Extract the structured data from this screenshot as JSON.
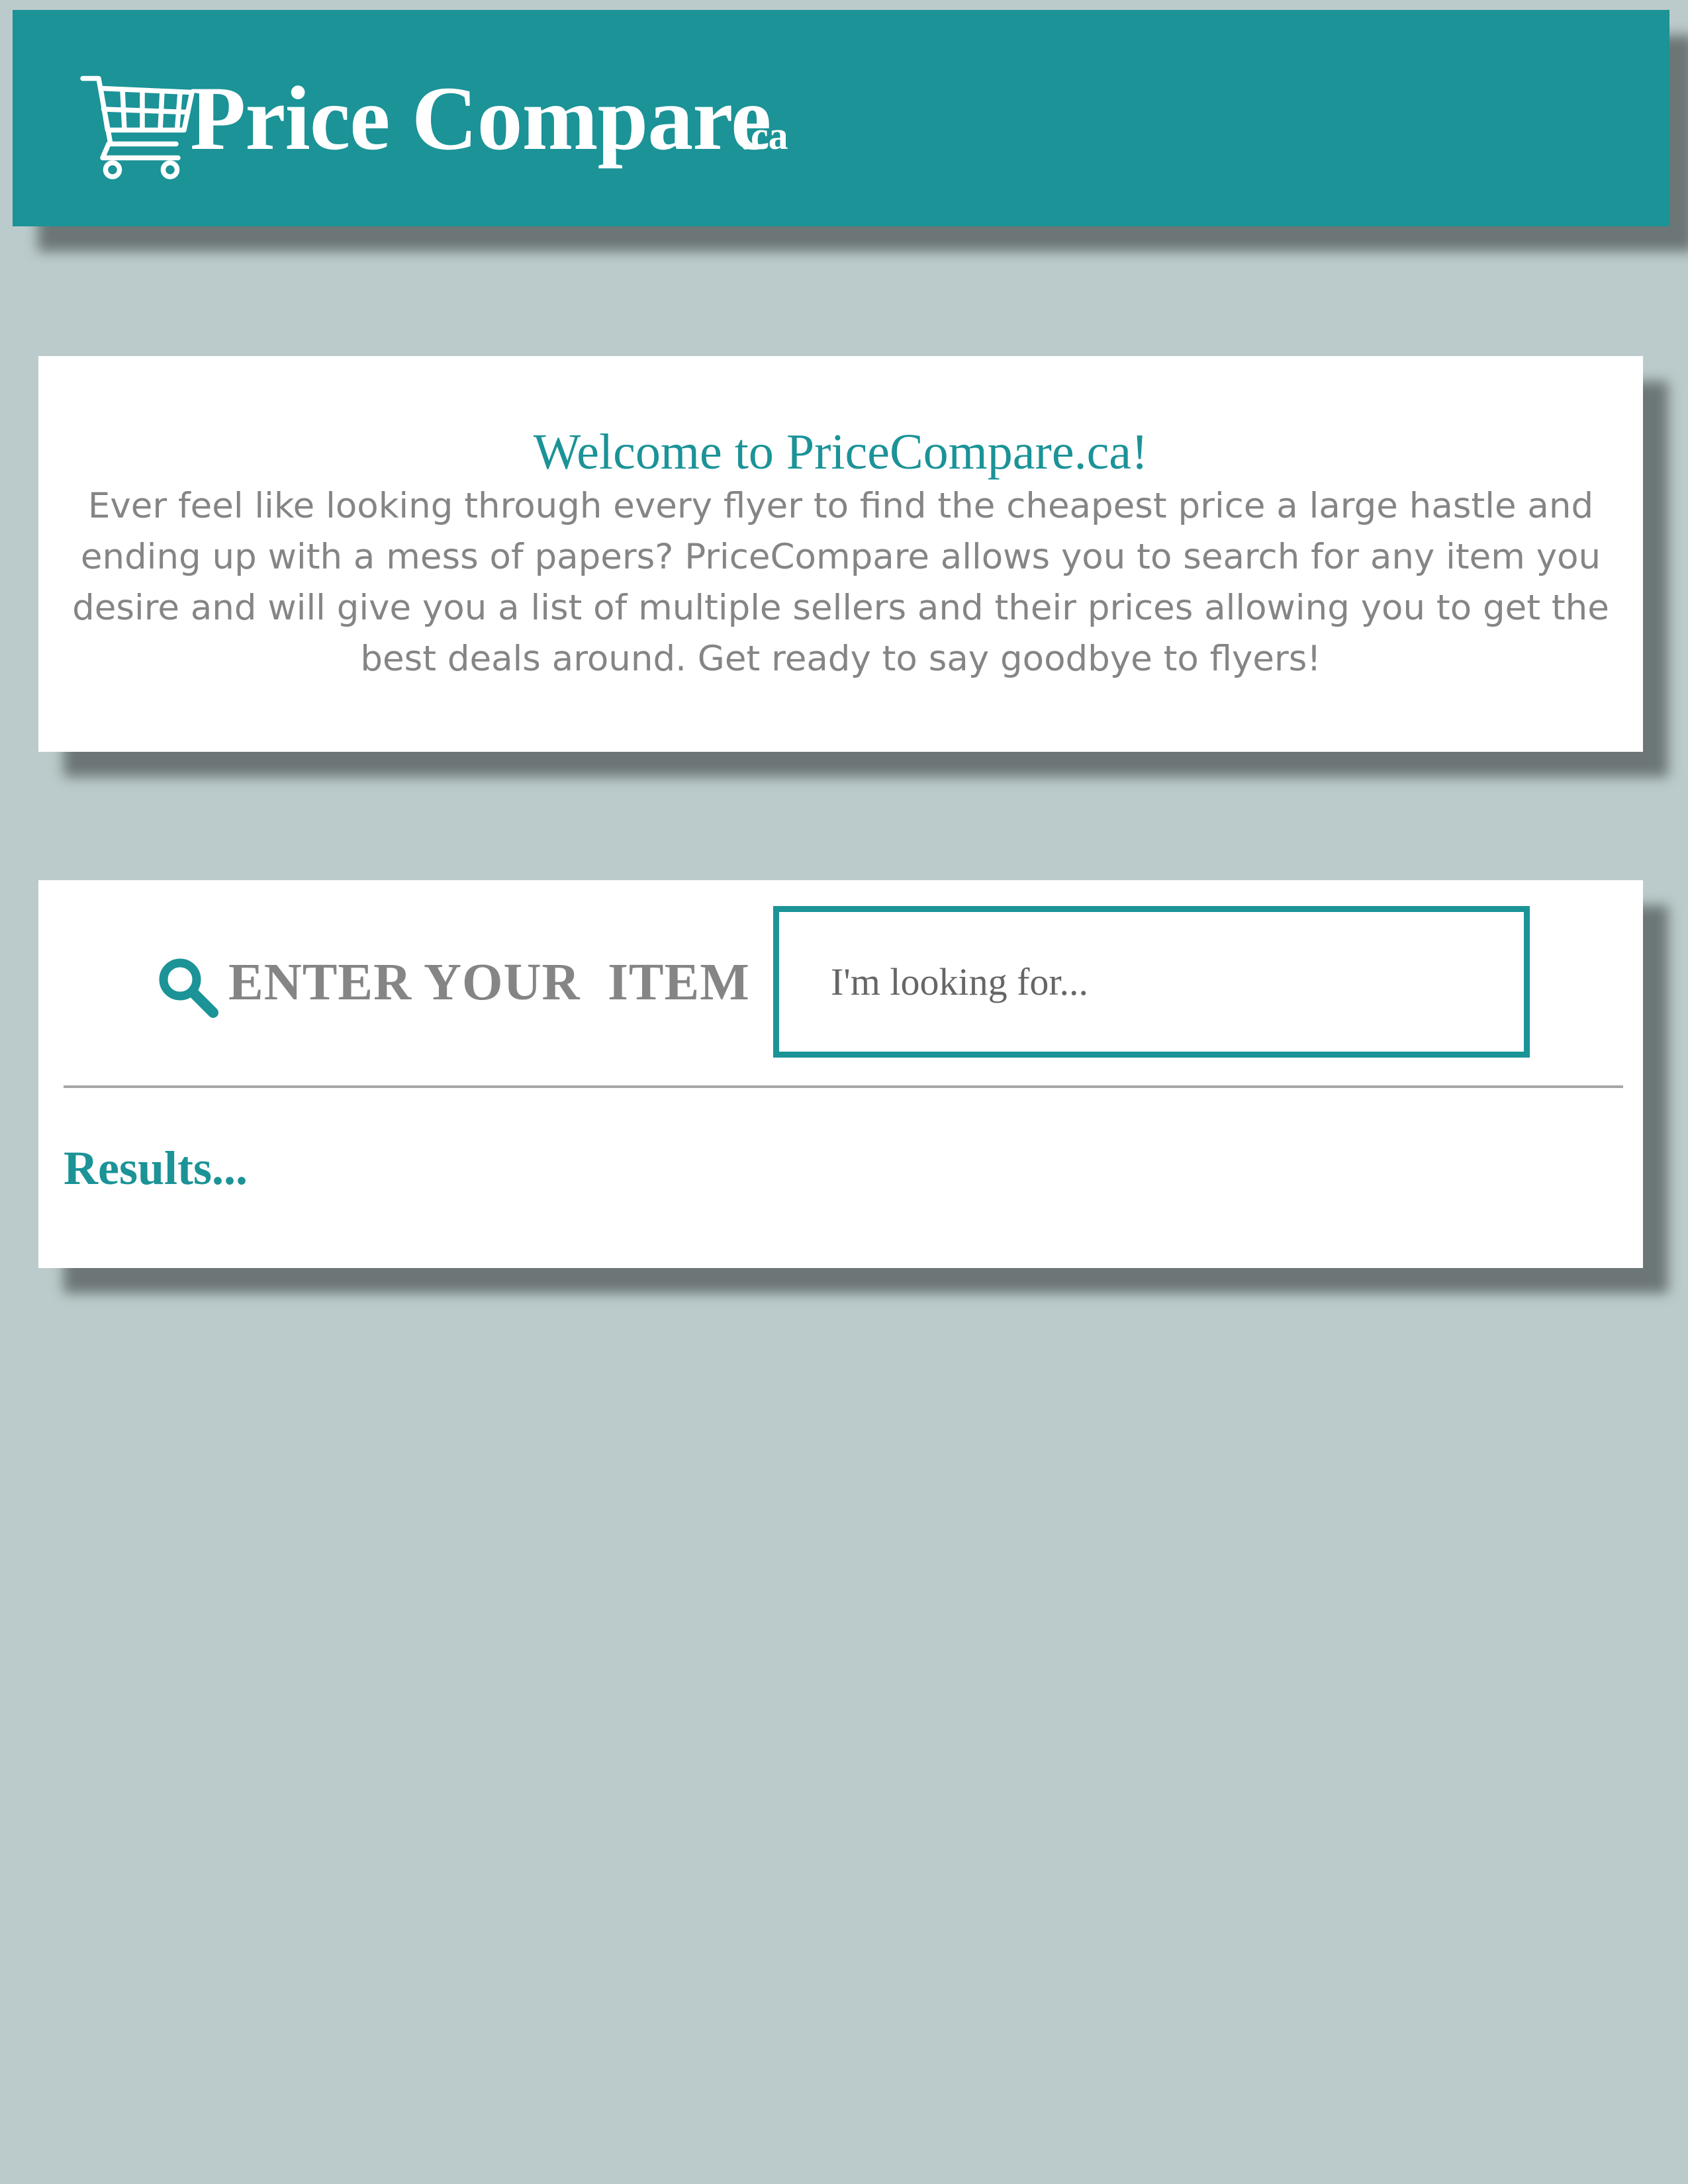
{
  "colors": {
    "brand": "#1b9397",
    "background": "#bbcbcb",
    "card": "#ffffff",
    "muted_text": "#858585"
  },
  "header": {
    "brand_name": "Price Compare",
    "brand_tld": ".ca",
    "logo_icon": "shopping-cart-icon"
  },
  "welcome": {
    "title": "Welcome to PriceCompare.ca!",
    "body": "Ever feel like looking through every flyer to find the cheapest price a large hastle and ending up with a mess of papers? PriceCompare allows you to search for any item you desire and will give you a list of multiple sellers and their prices allowing you to get the best deals around. Get ready to say goodbye to flyers!"
  },
  "search": {
    "icon": "magnifier-icon",
    "label": "ENTER YOUR  ITEM",
    "input_value": "",
    "placeholder": "I'm looking for...",
    "results_label": "Results..."
  }
}
